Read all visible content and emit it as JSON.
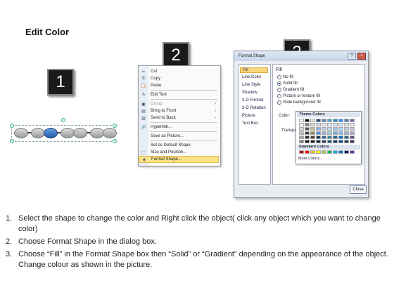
{
  "title": "Edit Color",
  "step_numbers": [
    "1",
    "2",
    "3"
  ],
  "context_menu": {
    "items": [
      {
        "icon": "scissors-icon",
        "glyph": "✂",
        "label": "Cut",
        "state": "normal"
      },
      {
        "icon": "copy-icon",
        "glyph": "⎘",
        "label": "Copy",
        "state": "normal"
      },
      {
        "icon": "paste-icon",
        "glyph": "📋",
        "label": "Paste",
        "state": "normal"
      },
      {
        "icon": "edit-text-icon",
        "glyph": "A",
        "label": "Edit Text",
        "state": "normal"
      },
      {
        "icon": "group-icon",
        "glyph": "▣",
        "label": "Group",
        "state": "disabled"
      },
      {
        "icon": "bring-front-icon",
        "glyph": "▤",
        "label": "Bring to Front",
        "state": "normal"
      },
      {
        "icon": "send-back-icon",
        "glyph": "▥",
        "label": "Send to Back",
        "state": "normal"
      },
      {
        "icon": "hyperlink-icon",
        "glyph": "🔗",
        "label": "Hyperlink...",
        "state": "normal"
      },
      {
        "icon": "",
        "glyph": "",
        "label": "Save as Picture...",
        "state": "normal"
      },
      {
        "icon": "",
        "glyph": "",
        "label": "Set as Default Shape",
        "state": "normal"
      },
      {
        "icon": "size-position-icon",
        "glyph": "⬚",
        "label": "Size and Position...",
        "state": "normal"
      },
      {
        "icon": "format-shape-icon",
        "glyph": "◈",
        "label": "Format Shape...",
        "state": "highlighted"
      }
    ]
  },
  "format_dialog": {
    "title": "Format Shape",
    "nav": [
      "Fill",
      "Line Color",
      "Line Style",
      "Shadow",
      "3-D Format",
      "3-D Rotation",
      "Picture",
      "Text Box"
    ],
    "selected_nav": "Fill",
    "heading": "Fill",
    "options": [
      "No fill",
      "Solid fill",
      "Gradient fill",
      "Picture or texture fill",
      "Slide background fill"
    ],
    "selected_option": "Solid fill",
    "color_label": "Color:",
    "transparency_label": "Transpa",
    "close_label": "Close",
    "selected_color": "#2b6fc7"
  },
  "palette": {
    "theme_label": "Theme Colors",
    "standard_label": "Standard Colors",
    "more_label": "More Colors...",
    "theme_columns": [
      [
        "#ffffff",
        "#f2f2f2",
        "#d9d9d9",
        "#bfbfbf",
        "#a6a6a6",
        "#7f7f7f"
      ],
      [
        "#000000",
        "#7f7f7f",
        "#595959",
        "#404040",
        "#262626",
        "#0d0d0d"
      ],
      [
        "#eeece1",
        "#ddd9c4",
        "#c4bd97",
        "#948b54",
        "#4a452a",
        "#1e1c11"
      ],
      [
        "#1f497d",
        "#c6d9f1",
        "#8eb4e3",
        "#558ed5",
        "#17375e",
        "#0f243e"
      ],
      [
        "#4f81bd",
        "#dbe5f1",
        "#b9cde5",
        "#95b3d7",
        "#376092",
        "#254061"
      ],
      [
        "#4bacc6",
        "#dbeef4",
        "#b7dee8",
        "#93cddd",
        "#31859c",
        "#215968"
      ],
      [
        "#2c7fb8",
        "#cde4f4",
        "#9cc9ea",
        "#6aaedf",
        "#1f5e8a",
        "#143f5c"
      ],
      [
        "#1e90ff",
        "#d2e9ff",
        "#a5d3ff",
        "#78bdff",
        "#0f6ac8",
        "#0a4785"
      ],
      [
        "#4682b4",
        "#dae6f0",
        "#b5cde1",
        "#90b4d2",
        "#345f85",
        "#223f58"
      ],
      [
        "#8064a2",
        "#e5e0ec",
        "#ccc1da",
        "#b3a2c7",
        "#604a7b",
        "#403152"
      ]
    ],
    "standard_colors": [
      "#c00000",
      "#ff0000",
      "#ffc000",
      "#ffff00",
      "#92d050",
      "#00b050",
      "#00b0f0",
      "#0070c0",
      "#002060",
      "#7030a0"
    ]
  },
  "instructions": [
    {
      "num": "1.",
      "text": "Select the shape to change the color and Right click the object( click any object which you want to change color)"
    },
    {
      "num": "2.",
      "text": "Choose Format Shape in the dialog box."
    },
    {
      "num": "3.",
      "text": "Choose “Fill” in the Format Shape box then “Solid” or “Gradient” depending on the appearance of the object. Change colour as shown in the picture."
    }
  ]
}
